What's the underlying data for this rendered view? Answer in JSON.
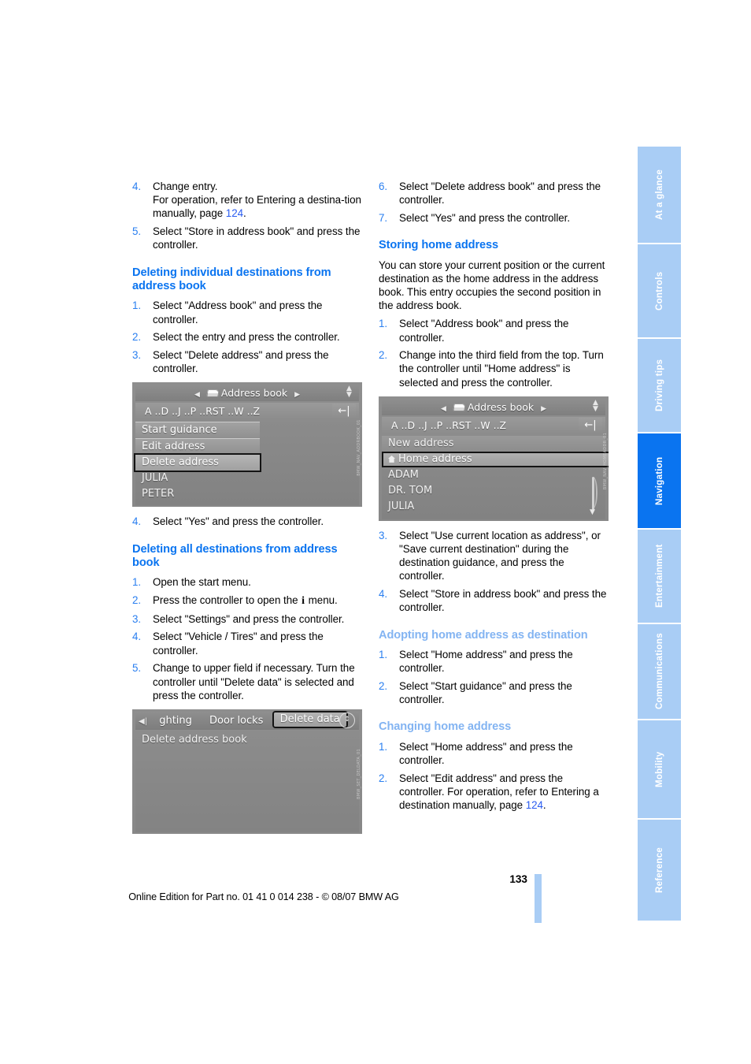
{
  "page": {
    "number": "133",
    "footer_note": "Online Edition for Part no. 01 41 0 014 238 - © 08/07 BMW AG"
  },
  "left_column": {
    "steps_continued": [
      {
        "num": "4.",
        "text": "Change entry.\nFor operation, refer to Entering a destination manually, page 124."
      },
      {
        "num": "5.",
        "text": "Select \"Store in address book\" and press the controller."
      }
    ],
    "step4_line1": "Change entry.",
    "step4_line2_a": "For operation, refer to Entering a destina-tion manually, page ",
    "step4_page_ref": "124",
    "step4_line2_b": ".",
    "step5_text": "Select \"Store in address book\" and press the controller.",
    "heading_delete_individual": "Deleting individual destinations from address book",
    "delete_individual_steps": [
      {
        "num": "1.",
        "text": "Select \"Address book\" and press the controller."
      },
      {
        "num": "2.",
        "text": "Select the entry and press the controller."
      },
      {
        "num": "3.",
        "text": "Select \"Delete address\" and press the controller."
      }
    ],
    "after_shot_step": {
      "num": "4.",
      "text": "Select \"Yes\" and press the controller."
    },
    "heading_delete_all": "Deleting all destinations from address book",
    "delete_all_steps": [
      {
        "num": "1.",
        "text": "Open the start menu."
      },
      {
        "num": "2.",
        "text": "Press the controller to open the  menu."
      },
      {
        "num": "3.",
        "text": "Select \"Settings\" and press the controller."
      },
      {
        "num": "4.",
        "text": "Select \"Vehicle / Tires\" and press the controller."
      },
      {
        "num": "5.",
        "text": "Change to upper field if necessary. Turn the controller until \"Delete data\" is selected and press the controller."
      }
    ],
    "step2_part_a": "Press the controller to open the ",
    "step2_idrive_glyph": "i",
    "step2_part_b": " menu."
  },
  "right_column": {
    "steps_continued": [
      {
        "num": "6.",
        "text": "Select \"Delete address book\" and press the controller."
      },
      {
        "num": "7.",
        "text": "Select \"Yes\" and press the controller."
      }
    ],
    "heading_storing_home": "Storing home address",
    "storing_home_paragraph": "You can store your current position or the current destination as the home address in the address book. This entry occupies the second position in the address book.",
    "storing_home_steps": [
      {
        "num": "1.",
        "text": "Select \"Address book\" and press the controller."
      },
      {
        "num": "2.",
        "text": "Change into the third field from the top. Turn the controller until \"Home address\" is selected and press the controller."
      }
    ],
    "storing_home_steps_after": [
      {
        "num": "3.",
        "text": "Select \"Use current location as address\", or \"Save current destination\" during the destination guidance, and press the controller."
      },
      {
        "num": "4.",
        "text": "Select \"Store in address book\" and press the controller."
      }
    ],
    "heading_adopting_home": "Adopting home address as destination",
    "adopting_home_steps": [
      {
        "num": "1.",
        "text": "Select \"Home address\" and press the controller."
      },
      {
        "num": "2.",
        "text": "Select \"Start guidance\" and press the controller."
      }
    ],
    "heading_changing_home": "Changing home address",
    "changing_home_steps": [
      {
        "num": "1.",
        "text": "Select \"Home address\" and press the controller."
      }
    ],
    "changing_step2_a": "Select \"Edit address\" and press the controller. For operation, refer to Entering a destination manually, page ",
    "changing_step2_ref": "124",
    "changing_step2_b": "."
  },
  "screenshots": {
    "address_book_delete": {
      "title": "Address book",
      "letters": "A ..D ..J ..P ..RST ..W ..Z",
      "back_glyph": "←|",
      "menu_items": [
        "Start guidance",
        "Edit address"
      ],
      "selected_item": "Delete address",
      "list_items": [
        "JULIA",
        "PETER"
      ],
      "fig_id": "BMW_NAV_ADDRBOOK_01"
    },
    "delete_data": {
      "tabs": [
        "ghting",
        "Door locks"
      ],
      "selected_tab": "Delete data",
      "body_rows": [
        "Delete address book"
      ],
      "fig_id": "BMW_SET_DELDATA_01"
    },
    "address_book_home": {
      "title": "Address book",
      "letters": "A ..D ..J ..P ..RST ..W ..Z",
      "back_glyph": "←|",
      "first_row": "New address",
      "selected_item": "Home address",
      "list_items": [
        "ADAM",
        "DR. TOM",
        "JULIA"
      ],
      "fig_id": "BMW_NAV_HOMEADDR_01"
    }
  },
  "rail": {
    "tabs": [
      {
        "label": "At a glance",
        "active": false
      },
      {
        "label": "Controls",
        "active": false
      },
      {
        "label": "Driving tips",
        "active": false
      },
      {
        "label": "Navigation",
        "active": true
      },
      {
        "label": "Entertainment",
        "active": false
      },
      {
        "label": "Communications",
        "active": false
      },
      {
        "label": "Mobility",
        "active": false
      },
      {
        "label": "Reference",
        "active": false
      }
    ]
  },
  "colors": {
    "heading_strong": "#0a74f0",
    "heading_soft": "#83b4f2",
    "list_number": "#2a7ff0",
    "xref": "#2a5cf0",
    "rail_inactive": "#a9cdf5",
    "rail_active": "#0a74f0"
  }
}
